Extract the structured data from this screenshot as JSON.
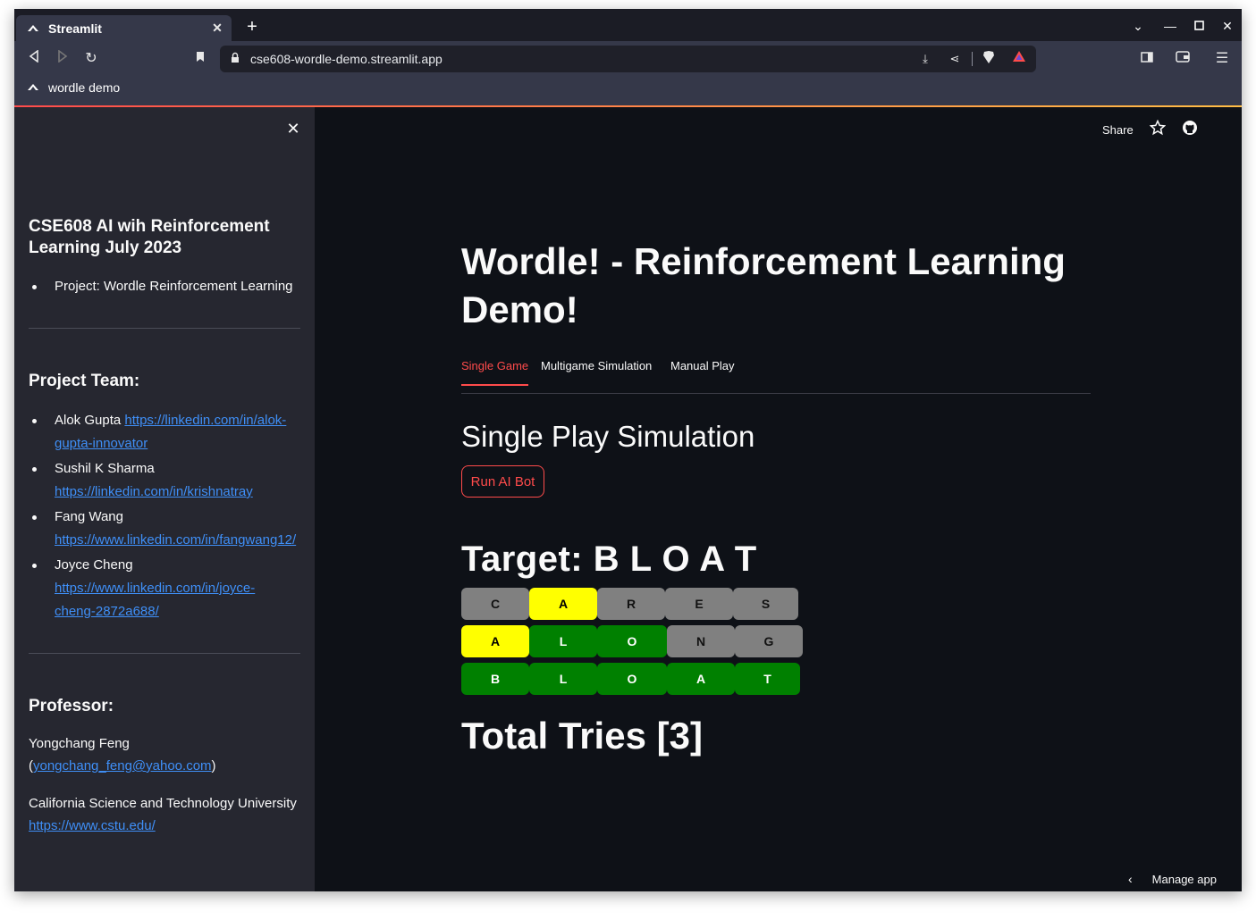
{
  "browser": {
    "tab_title": "Streamlit",
    "url": "cse608-wordle-demo.streamlit.app",
    "bookmark_label": "wordle demo"
  },
  "sidebar": {
    "course_title": "CSE608 AI wih Reinforcement Learning July 2023",
    "project_item": "Project: Wordle Reinforcement Learning",
    "team_heading": "Project Team:",
    "team": [
      {
        "name": "Alok Gupta",
        "link_line1": "https://linkedin.com/in/alok-",
        "link_line2": "gupta-innovator"
      },
      {
        "name": "Sushil K Sharma",
        "link": "https://linkedin.com/in/krishnatray"
      },
      {
        "name": "Fang Wang",
        "link": "https://www.linkedin.com/in/fangwang12/"
      },
      {
        "name": "Joyce Cheng",
        "link_line1": "https://www.linkedin.com/in/joyce-",
        "link_line2": "cheng-2872a688/"
      }
    ],
    "professor_heading": "Professor:",
    "professor_name": "Yongchang Feng",
    "professor_email": "yongchang_feng@yahoo.com",
    "university": "California Science and Technology University",
    "university_link": "https://www.cstu.edu/"
  },
  "header": {
    "share_label": "Share"
  },
  "main": {
    "title": "Wordle! - Reinforcement Learning Demo!",
    "tabs": [
      {
        "label": "Single Game",
        "active": true
      },
      {
        "label": "Multigame Simulation",
        "active": false
      },
      {
        "label": "Manual Play",
        "active": false
      }
    ],
    "subheader": "Single Play Simulation",
    "run_button": "Run AI Bot",
    "target_label": "Target: B L O A T",
    "board": [
      [
        {
          "letter": "C",
          "state": "absent"
        },
        {
          "letter": "A",
          "state": "present"
        },
        {
          "letter": "R",
          "state": "absent"
        },
        {
          "letter": "E",
          "state": "absent"
        },
        {
          "letter": "S",
          "state": "absent"
        }
      ],
      [
        {
          "letter": "A",
          "state": "present"
        },
        {
          "letter": "L",
          "state": "correct"
        },
        {
          "letter": "O",
          "state": "correct"
        },
        {
          "letter": "N",
          "state": "absent"
        },
        {
          "letter": "G",
          "state": "absent"
        }
      ],
      [
        {
          "letter": "B",
          "state": "correct"
        },
        {
          "letter": "L",
          "state": "correct"
        },
        {
          "letter": "O",
          "state": "correct"
        },
        {
          "letter": "A",
          "state": "correct"
        },
        {
          "letter": "T",
          "state": "correct"
        }
      ]
    ],
    "total_tries": "Total Tries [3]"
  },
  "footer": {
    "manage_app": "Manage app"
  },
  "colors": {
    "accent": "#ff4b4b",
    "correct": "#008000",
    "present": "#ffff00",
    "absent": "#808080",
    "link": "#3f8ff7"
  }
}
